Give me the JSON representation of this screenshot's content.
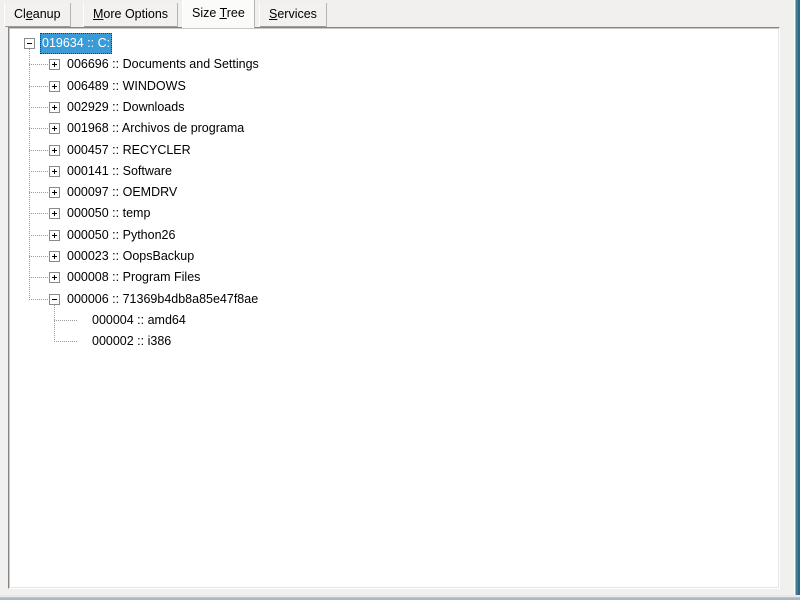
{
  "window": {
    "accent_color": "#3f7b93",
    "panel_bg": "#ffffff",
    "chrome_bg": "#f1f0ef",
    "selection_color": "#3a9bd9"
  },
  "tabs": [
    {
      "id": "cleanup",
      "label": "Cleanup",
      "accel": "e",
      "active": false
    },
    {
      "id": "more-options",
      "label": "More Options",
      "accel": "M",
      "active": false
    },
    {
      "id": "size-tree",
      "label": "Size Tree",
      "accel": "T",
      "active": true
    },
    {
      "id": "services",
      "label": "Services",
      "accel": "S",
      "active": false
    }
  ],
  "tree": {
    "root": {
      "size": "019634",
      "separator": "::",
      "name": "C:",
      "text": "019634 :: C:",
      "expanded": true,
      "selected": true,
      "toggle_icon": "minus-box-icon"
    },
    "children": [
      {
        "size": "006696",
        "name": "Documents and Settings",
        "text": "006696 :: Documents and Settings",
        "expanded": false,
        "toggle_icon": "plus-box-icon"
      },
      {
        "size": "006489",
        "name": "WINDOWS",
        "text": "006489 :: WINDOWS",
        "expanded": false,
        "toggle_icon": "plus-box-icon"
      },
      {
        "size": "002929",
        "name": "Downloads",
        "text": "002929 :: Downloads",
        "expanded": false,
        "toggle_icon": "plus-box-icon"
      },
      {
        "size": "001968",
        "name": "Archivos de programa",
        "text": "001968 :: Archivos de programa",
        "expanded": false,
        "toggle_icon": "plus-box-icon"
      },
      {
        "size": "000457",
        "name": "RECYCLER",
        "text": "000457 :: RECYCLER",
        "expanded": false,
        "toggle_icon": "plus-box-icon"
      },
      {
        "size": "000141",
        "name": "Software",
        "text": "000141 :: Software",
        "expanded": false,
        "toggle_icon": "plus-box-icon"
      },
      {
        "size": "000097",
        "name": "OEMDRV",
        "text": "000097 :: OEMDRV",
        "expanded": false,
        "toggle_icon": "plus-box-icon"
      },
      {
        "size": "000050",
        "name": "temp",
        "text": "000050 :: temp",
        "expanded": false,
        "toggle_icon": "plus-box-icon"
      },
      {
        "size": "000050",
        "name": "Python26",
        "text": "000050 :: Python26",
        "expanded": false,
        "toggle_icon": "plus-box-icon"
      },
      {
        "size": "000023",
        "name": "OopsBackup",
        "text": "000023 :: OopsBackup",
        "expanded": false,
        "toggle_icon": "plus-box-icon"
      },
      {
        "size": "000008",
        "name": "Program Files",
        "text": "000008 :: Program Files",
        "expanded": false,
        "toggle_icon": "plus-box-icon"
      },
      {
        "size": "000006",
        "name": "71369b4db8a85e47f8ae",
        "text": "000006 :: 71369b4db8a85e47f8ae",
        "expanded": true,
        "toggle_icon": "minus-box-icon",
        "children": [
          {
            "size": "000004",
            "name": "amd64",
            "text": "000004 :: amd64",
            "leaf": true
          },
          {
            "size": "000002",
            "name": "i386",
            "text": "000002 :: i386",
            "leaf": true
          }
        ]
      }
    ]
  }
}
